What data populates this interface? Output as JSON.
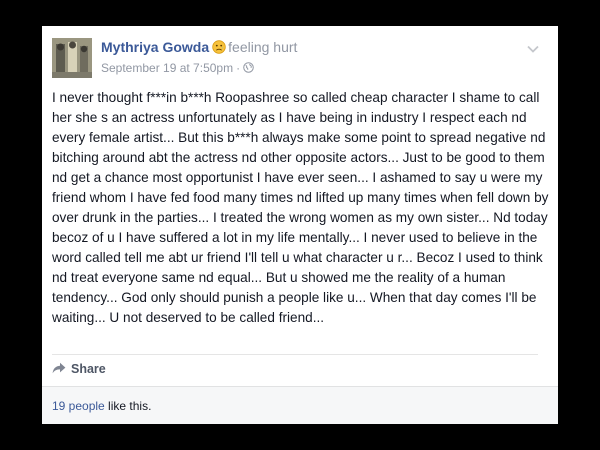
{
  "post": {
    "author": "Mythriya Gowda",
    "feeling": "feeling hurt",
    "feeling_icon": "sad-face-icon",
    "timestamp": "September 19 at 7:50pm",
    "separator": "·",
    "privacy_icon": "globe-icon",
    "body": "I never thought f***in b***h Roopashree so called cheap character I shame to call her she s an actress unfortunately as I have being in industry I respect each nd every female artist... But this b***h always make some point to spread negative nd bitching around abt the actress nd other opposite actors... Just to be good to them nd get a chance most opportunist I have ever seen... I ashamed to say u were my friend whom I have fed food many times nd lifted up many times when fell down by over drunk in the parties... I treated the wrong women as my own sister... Nd today becoz of u I have suffered a lot in my life mentally... I never used to believe in the word called tell me abt ur friend I'll tell u what character u r... Becoz I used to think nd treat everyone same nd equal... But u showed me the reality of a human tendency... God only should punish a people like u... When that day comes I'll be waiting... U not deserved to be called friend..."
  },
  "actions": {
    "share_label": "Share",
    "share_icon": "share-arrow-icon"
  },
  "likes": {
    "count_link": "19 people",
    "suffix": " like this."
  },
  "colors": {
    "link_blue": "#3b5998",
    "meta_gray": "#9197a3",
    "body_text": "#141823",
    "footer_bg": "#f6f7f8",
    "page_bg": "#000000"
  }
}
